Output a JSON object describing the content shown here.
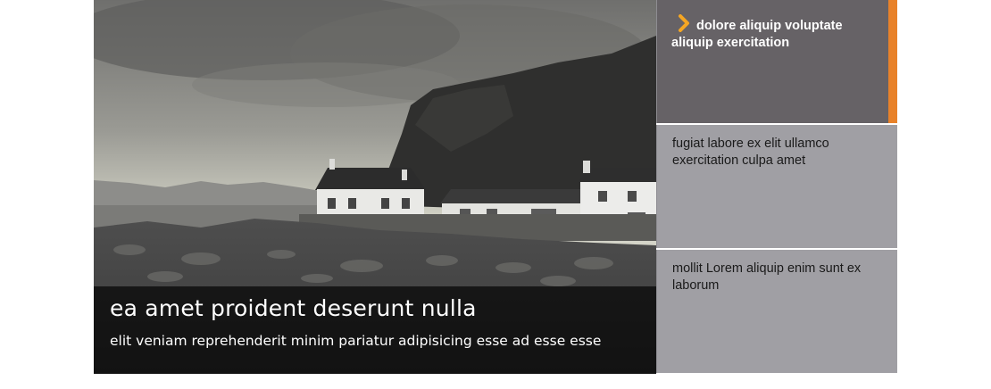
{
  "slide": {
    "title": "ea amet proident deserunt nulla",
    "subtitle": "elit veniam reprehenderit minim pariatur adipisicing esse ad esse esse",
    "image": "black-and-white photo of white cottages on a rocky shore below a cliff"
  },
  "panel": {
    "items": [
      {
        "label": "dolore aliquip voluptate aliquip exercitation",
        "active": true,
        "icon": "chevron-right-icon"
      },
      {
        "label": "fugiat labore ex elit ullamco exercitation culpa amet",
        "active": false
      },
      {
        "label": "mollit Lorem aliquip enim sunt ex laborum",
        "active": false
      }
    ]
  },
  "colors": {
    "active_bg": "#666266",
    "inactive_bg": "#a09fa4",
    "accent": "#e8822a",
    "chevron": "#f5a623"
  }
}
